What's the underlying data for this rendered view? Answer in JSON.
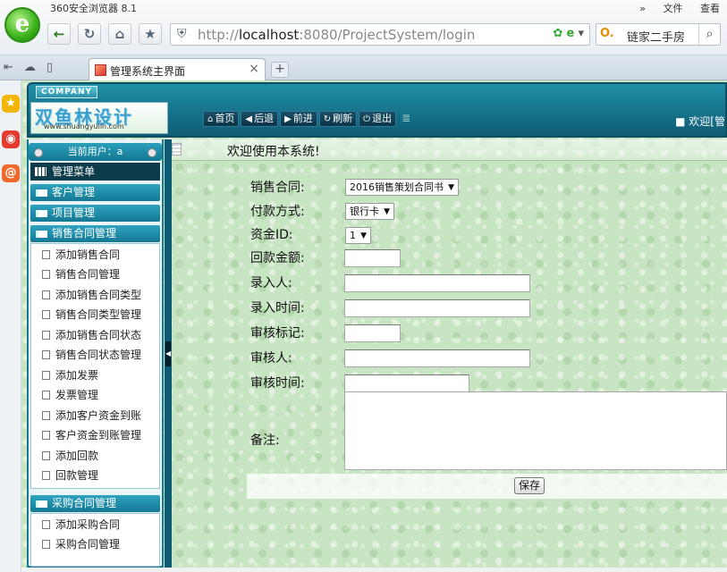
{
  "browser": {
    "name": "360安全浏览器 8.1",
    "menu_arrows": "»",
    "menu": [
      "文件",
      "查看"
    ],
    "url_prefix": "http://",
    "url_host": "localhost",
    "url_rest": ":8080/ProjectSystem/login",
    "search_engine_icon": "O.",
    "search_text": "链家二手房",
    "tab_title": "管理系统主界面",
    "tab_close": "×",
    "new_tab": "+",
    "icons": [
      "back-icon",
      "refresh-icon",
      "home-icon",
      "favorite-star-icon",
      "shield-icon",
      "search-icon"
    ]
  },
  "header": {
    "company_tag": "COMPANY",
    "logo_title": "双鱼林设计",
    "logo_url": "www.shuangyulin.com",
    "nav": [
      {
        "icon": "⌂",
        "label": "首页"
      },
      {
        "icon": "◀",
        "label": "后退"
      },
      {
        "icon": "▶",
        "label": "前进"
      },
      {
        "icon": "↻",
        "label": "刷新"
      },
      {
        "icon": "⏻",
        "label": "退出"
      }
    ],
    "welcome": "■ 欢迎[管"
  },
  "sidebar": {
    "current_user": "当前用户：a",
    "menu_title": "管理菜单",
    "categories": [
      "客户管理",
      "项目管理",
      "销售合同管理",
      "采购合同管理"
    ],
    "sales_items": [
      "添加销售合同",
      "销售合同管理",
      "添加销售合同类型",
      "销售合同类型管理",
      "添加销售合同状态",
      "销售合同状态管理",
      "添加发票",
      "发票管理",
      "添加客户资金到账",
      "客户资金到账管理",
      "添加回款",
      "回款管理"
    ],
    "purchase_items": [
      "添加采购合同",
      "采购合同管理"
    ]
  },
  "content": {
    "title": "欢迎使用本系统!",
    "form": {
      "sales_contract_label": "销售合同:",
      "sales_contract_value": "2016销售策划合同书",
      "payment_method_label": "付款方式:",
      "payment_method_value": "银行卡",
      "fund_id_label": "资金ID:",
      "fund_id_value": "1",
      "amount_label": "回款金额:",
      "entered_by_label": "录入人:",
      "entered_time_label": "录入时间:",
      "audit_flag_label": "审核标记:",
      "auditor_label": "审核人:",
      "audit_time_label": "审核时间:",
      "remark_label": "备注:",
      "save_label": "保存"
    }
  },
  "colors": {
    "header_teal": "#167a95",
    "page_green": "#c8e5c3",
    "dark_nav": "#0c3446"
  }
}
